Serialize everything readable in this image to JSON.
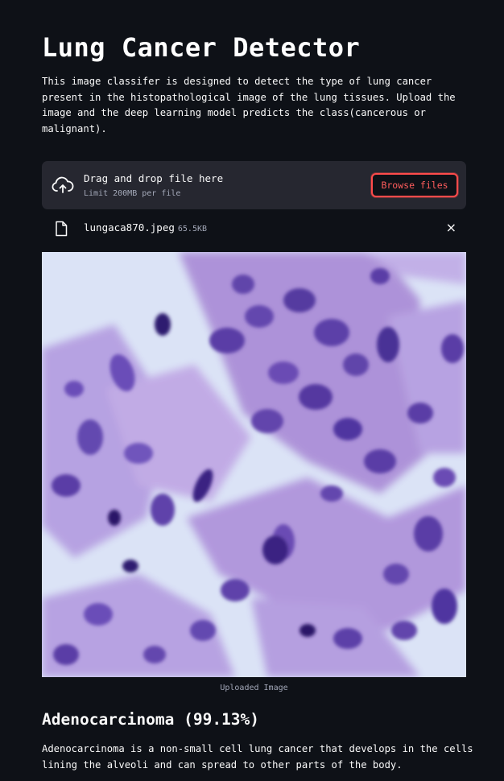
{
  "page": {
    "title": "Lung Cancer Detector",
    "intro": "This image classifer is designed to detect the type of lung cancer present in the histopathological image of the lung tissues. Upload the image and the deep learning model predicts the class(cancerous or malignant)."
  },
  "uploader": {
    "drop_text": "Drag and drop file here",
    "limit_text": "Limit 200MB per file",
    "browse_label": "Browse files",
    "upload_icon": "cloud-upload-icon"
  },
  "file": {
    "name": "lungaca870.jpeg",
    "size": "65.5KB",
    "file_icon": "file-icon",
    "close_icon": "close-icon",
    "close_glyph": "×"
  },
  "image": {
    "caption": "Uploaded Image"
  },
  "result": {
    "label": "Adenocarcinoma (99.13%)",
    "description": "Adenocarcinoma is a non-small cell lung cancer that develops in the cells lining the alveoli and can spread to other parts of the body."
  },
  "colors": {
    "background": "#0e1117",
    "uploader_bg": "#262730",
    "accent": "#ff4b4b",
    "muted_text": "#a3a8b8",
    "tissue_background": "#d9e2f4"
  }
}
